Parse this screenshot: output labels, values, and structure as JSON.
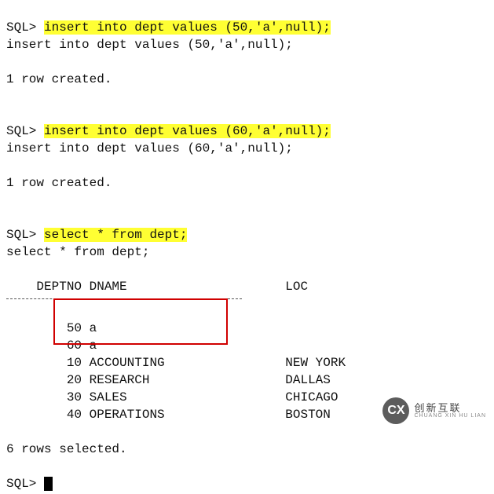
{
  "prompt": "SQL>",
  "commands": {
    "insert50": "insert into dept values (50,'a',null);",
    "insert50_echo": "insert into dept values (50,'a',null);",
    "insert60": "insert into dept values (60,'a',null);",
    "insert60_echo": "insert into dept values (60,'a',null);",
    "select": "select * from dept;",
    "select_echo": "select * from dept;"
  },
  "messages": {
    "row_created": "1 row created.",
    "rows_selected": "6 rows selected."
  },
  "columns": {
    "deptno": "DEPTNO",
    "dname": "DNAME",
    "loc": "LOC"
  },
  "chart_data": {
    "type": "table",
    "columns": [
      "DEPTNO",
      "DNAME",
      "LOC"
    ],
    "rows": [
      {
        "deptno": 50,
        "dname": "a",
        "loc": ""
      },
      {
        "deptno": 60,
        "dname": "a",
        "loc": ""
      },
      {
        "deptno": 10,
        "dname": "ACCOUNTING",
        "loc": "NEW YORK"
      },
      {
        "deptno": 20,
        "dname": "RESEARCH",
        "loc": "DALLAS"
      },
      {
        "deptno": 30,
        "dname": "SALES",
        "loc": "CHICAGO"
      },
      {
        "deptno": 40,
        "dname": "OPERATIONS",
        "loc": "BOSTON"
      }
    ]
  },
  "logo": {
    "badge": "CX",
    "zh": "创新互联",
    "en": "CHUANG XIN HU LIAN"
  }
}
